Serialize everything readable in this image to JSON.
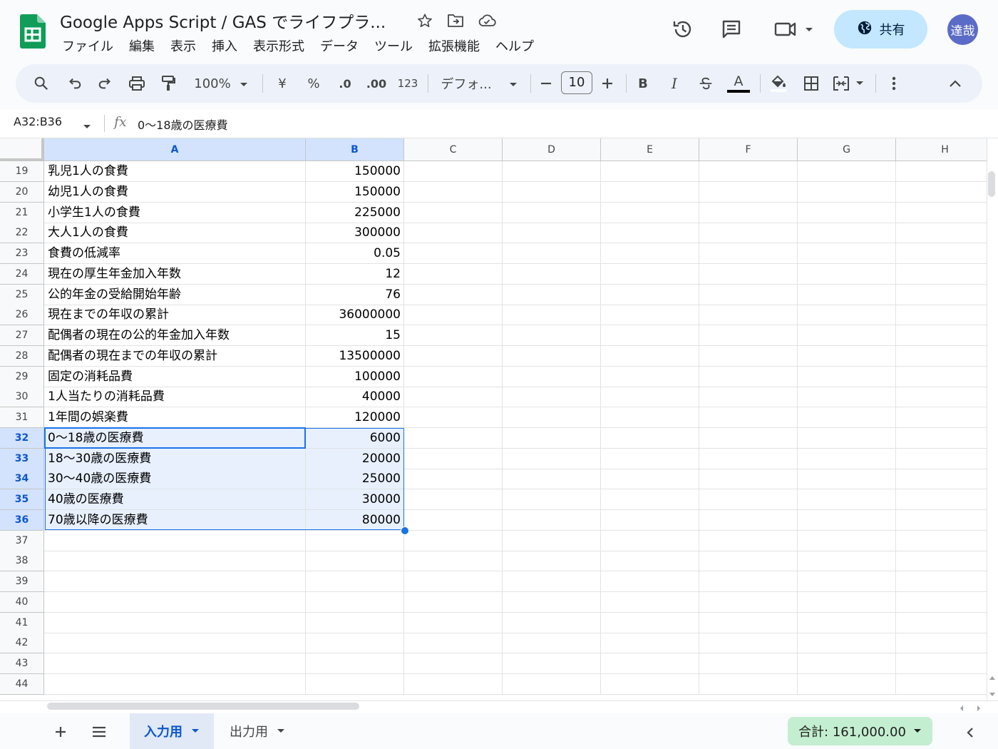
{
  "header": {
    "title": "Google Apps Script / GAS でライフプラ...",
    "share_label": "共有",
    "avatar_label": "達哉"
  },
  "menu": [
    "ファイル",
    "編集",
    "表示",
    "挿入",
    "表示形式",
    "データ",
    "ツール",
    "拡張機能",
    "ヘルプ"
  ],
  "toolbar": {
    "zoom": "100%",
    "currency": "¥",
    "percent": "%",
    "dec_decrease": ".0",
    "dec_increase": ".00",
    "number_format": "123",
    "font_name": "デフォ...",
    "font_size": "10",
    "bold": "B",
    "italic": "I",
    "text_color": "A"
  },
  "formula_bar": {
    "name_box": "A32:B36",
    "fx": "fx",
    "content": "0〜18歳の医療費"
  },
  "columns": [
    "A",
    "B",
    "C",
    "D",
    "E",
    "F",
    "G",
    "H"
  ],
  "rows": [
    {
      "n": "19",
      "a": "乳児1人の食費",
      "b": "150000"
    },
    {
      "n": "20",
      "a": "幼児1人の食費",
      "b": "150000"
    },
    {
      "n": "21",
      "a": "小学生1人の食費",
      "b": "225000"
    },
    {
      "n": "22",
      "a": "大人1人の食費",
      "b": "300000"
    },
    {
      "n": "23",
      "a": "食費の低減率",
      "b": "0.05"
    },
    {
      "n": "24",
      "a": "現在の厚生年金加入年数",
      "b": "12"
    },
    {
      "n": "25",
      "a": "公的年金の受給開始年齢",
      "b": "76"
    },
    {
      "n": "26",
      "a": "現在までの年収の累計",
      "b": "36000000"
    },
    {
      "n": "27",
      "a": "配偶者の現在の公的年金加入年数",
      "b": "15"
    },
    {
      "n": "28",
      "a": "配偶者の現在までの年収の累計",
      "b": "13500000"
    },
    {
      "n": "29",
      "a": "固定の消耗品費",
      "b": "100000"
    },
    {
      "n": "30",
      "a": "1人当たりの消耗品費",
      "b": "40000"
    },
    {
      "n": "31",
      "a": "1年間の娯楽費",
      "b": "120000"
    },
    {
      "n": "32",
      "a": "0〜18歳の医療費",
      "b": "6000"
    },
    {
      "n": "33",
      "a": "18〜30歳の医療費",
      "b": "20000"
    },
    {
      "n": "34",
      "a": "30〜40歳の医療費",
      "b": "25000"
    },
    {
      "n": "35",
      "a": "40歳の医療費",
      "b": "30000"
    },
    {
      "n": "36",
      "a": "70歳以降の医療費",
      "b": "80000"
    },
    {
      "n": "37",
      "a": "",
      "b": ""
    },
    {
      "n": "38",
      "a": "",
      "b": ""
    },
    {
      "n": "39",
      "a": "",
      "b": ""
    },
    {
      "n": "40",
      "a": "",
      "b": ""
    },
    {
      "n": "41",
      "a": "",
      "b": ""
    },
    {
      "n": "42",
      "a": "",
      "b": ""
    },
    {
      "n": "43",
      "a": "",
      "b": ""
    },
    {
      "n": "44",
      "a": "",
      "b": ""
    }
  ],
  "selected_rows": [
    "32",
    "33",
    "34",
    "35",
    "36"
  ],
  "sheets": {
    "input_tab": "入力用",
    "output_tab": "出力用",
    "sum_label": "合計: 161,000.00"
  },
  "colors": {
    "accent": "#1a73e8",
    "share_bg": "#c2e7ff",
    "sum_bg": "#c4eed0",
    "selection": "#e8f0fe"
  }
}
